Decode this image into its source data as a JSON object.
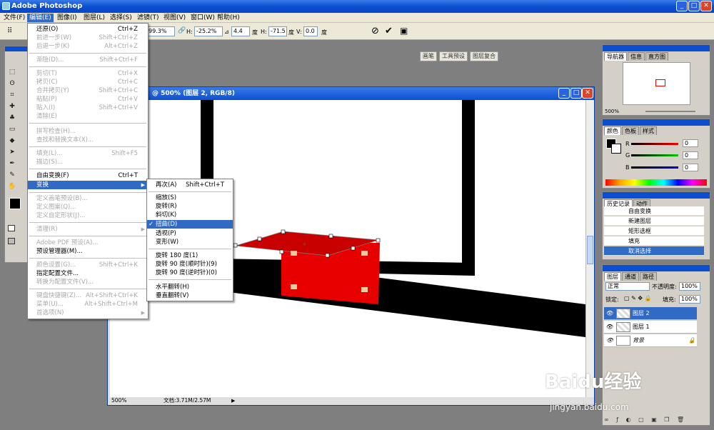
{
  "app": {
    "title": "Adobe Photoshop"
  },
  "menubar": [
    {
      "label": "文件(F)"
    },
    {
      "label": "编辑(E)"
    },
    {
      "label": "图像(I)"
    },
    {
      "label": "图层(L)"
    },
    {
      "label": "选择(S)"
    },
    {
      "label": "滤镜(T)"
    },
    {
      "label": "视图(V)"
    },
    {
      "label": "窗口(W)"
    },
    {
      "label": "帮助(H)"
    }
  ],
  "options": {
    "w_value": "99.3%",
    "h_label": "H:",
    "h_value": "-25.2%",
    "angle_value": "4.4",
    "deg": "度",
    "hskew_label": "H:",
    "hskew_value": "-71.5",
    "vskew_label": "V:",
    "vskew_value": "0.0",
    "palette_tabs": [
      "画笔",
      "工具预设",
      "图层复合"
    ]
  },
  "edit_menu": [
    {
      "label": "还原(O)",
      "shortcut": "Ctrl+Z",
      "enabled": true
    },
    {
      "label": "前进一步(W)",
      "shortcut": "Shift+Ctrl+Z",
      "enabled": false
    },
    {
      "label": "后退一步(K)",
      "shortcut": "Alt+Ctrl+Z",
      "enabled": false
    },
    {
      "label": "渐隐(D)...",
      "shortcut": "Shift+Ctrl+F",
      "enabled": false
    },
    {
      "label": "剪切(T)",
      "shortcut": "Ctrl+X",
      "enabled": false
    },
    {
      "label": "拷贝(C)",
      "shortcut": "Ctrl+C",
      "enabled": false
    },
    {
      "label": "合并拷贝(Y)",
      "shortcut": "Shift+Ctrl+C",
      "enabled": false
    },
    {
      "label": "粘贴(P)",
      "shortcut": "Ctrl+V",
      "enabled": false
    },
    {
      "label": "贴入(I)",
      "shortcut": "Shift+Ctrl+V",
      "enabled": false
    },
    {
      "label": "清除(E)",
      "shortcut": "",
      "enabled": false
    },
    {
      "label": "拼写检查(H)...",
      "shortcut": "",
      "enabled": false
    },
    {
      "label": "查找和替换文本(X)...",
      "shortcut": "",
      "enabled": false
    },
    {
      "label": "填充(L)...",
      "shortcut": "Shift+F5",
      "enabled": false
    },
    {
      "label": "描边(S)...",
      "shortcut": "",
      "enabled": false
    },
    {
      "label": "自由变换(F)",
      "shortcut": "Ctrl+T",
      "enabled": true
    },
    {
      "label": "变换",
      "shortcut": "",
      "enabled": true
    },
    {
      "label": "定义画笔预设(B)...",
      "shortcut": "",
      "enabled": false
    },
    {
      "label": "定义图案(Q)...",
      "shortcut": "",
      "enabled": false
    },
    {
      "label": "定义自定形状(J)...",
      "shortcut": "",
      "enabled": false
    },
    {
      "label": "清理(R)",
      "shortcut": "",
      "enabled": false
    },
    {
      "label": "Adobe PDF 预设(A)...",
      "shortcut": "",
      "enabled": false
    },
    {
      "label": "预设管理器(M)...",
      "shortcut": "",
      "enabled": true
    },
    {
      "label": "颜色设置(G)...",
      "shortcut": "Shift+Ctrl+K",
      "enabled": false
    },
    {
      "label": "指定配置文件...",
      "shortcut": "",
      "enabled": true
    },
    {
      "label": "转换为配置文件(V)...",
      "shortcut": "",
      "enabled": false
    },
    {
      "label": "键盘快捷键(Z)...",
      "shortcut": "Alt+Shift+Ctrl+K",
      "enabled": false
    },
    {
      "label": "菜单(U)...",
      "shortcut": "Alt+Shift+Ctrl+M",
      "enabled": false
    },
    {
      "label": "首选项(N)",
      "shortcut": "",
      "enabled": false
    }
  ],
  "transform_menu": [
    {
      "label": "再次(A)",
      "shortcut": "Shift+Ctrl+T"
    },
    {
      "label": "缩放(S)",
      "shortcut": ""
    },
    {
      "label": "旋转(R)",
      "shortcut": ""
    },
    {
      "label": "斜切(K)",
      "shortcut": ""
    },
    {
      "label": "扭曲(D)",
      "shortcut": ""
    },
    {
      "label": "透视(P)",
      "shortcut": ""
    },
    {
      "label": "变形(W)",
      "shortcut": ""
    },
    {
      "label": "旋转 180 度(1)",
      "shortcut": ""
    },
    {
      "label": "旋转 90 度(顺时针)(9)",
      "shortcut": ""
    },
    {
      "label": "旋转 90 度(逆时针)(0)",
      "shortcut": ""
    },
    {
      "label": "水平翻转(H)",
      "shortcut": ""
    },
    {
      "label": "垂直翻转(V)",
      "shortcut": ""
    }
  ],
  "document": {
    "title": "@ 500% (图层 2, RGB/8)",
    "zoom": "500%",
    "doc_size": "文档:3.71M/2.57M"
  },
  "navigator": {
    "tabs": [
      "导航器",
      "信息",
      "直方图"
    ],
    "zoom": "500%"
  },
  "color_panel": {
    "tabs": [
      "颜色",
      "色板",
      "样式"
    ],
    "channels": [
      "R",
      "G",
      "B"
    ],
    "values": [
      "0",
      "0",
      "0"
    ]
  },
  "history": {
    "tabs": [
      "历史记录",
      "动作"
    ],
    "items": [
      "自由变换",
      "新建图层",
      "矩形选框",
      "填充",
      "取消选择"
    ]
  },
  "layers": {
    "tabs": [
      "图层",
      "通道",
      "路径"
    ],
    "blend_mode": "正常",
    "opacity_label": "不透明度:",
    "opacity": "100%",
    "lock_label": "锁定:",
    "fill_label": "填充:",
    "fill": "100%",
    "items": [
      "图层 2",
      "图层 1",
      "背景"
    ]
  },
  "watermark": {
    "text": "Baidu经验",
    "sub": "jingyan.baidu.com"
  }
}
